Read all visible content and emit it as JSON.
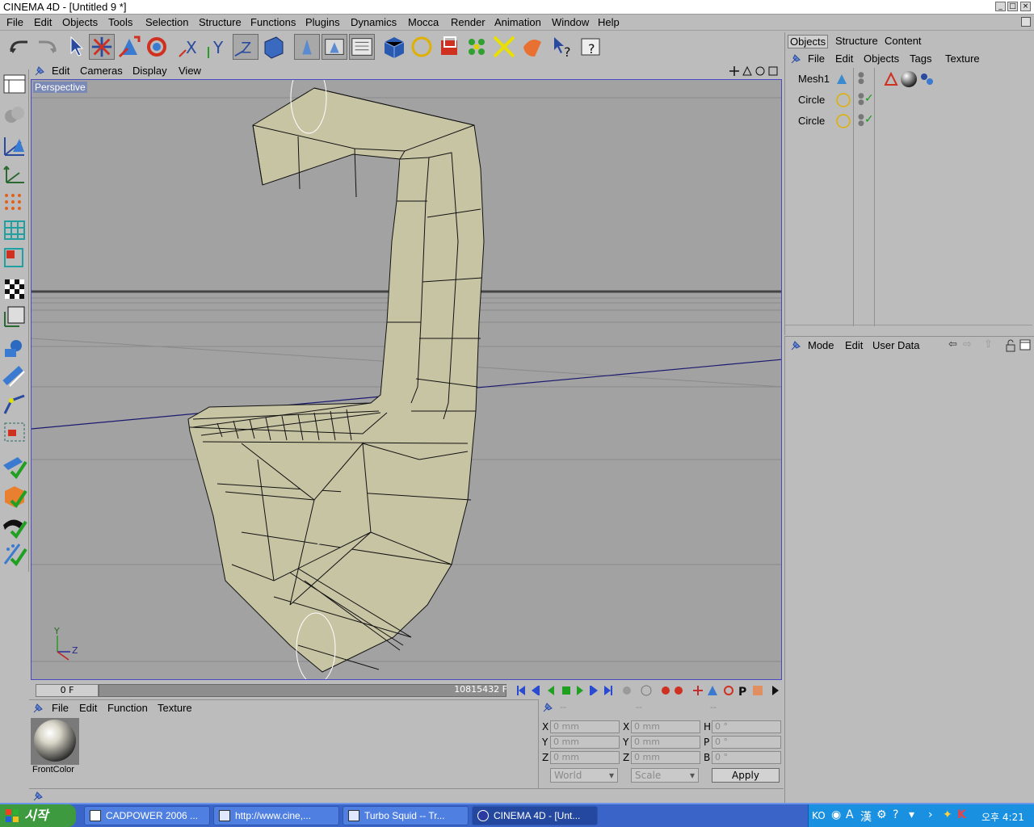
{
  "window": {
    "title": "CINEMA 4D - [Untitled 9 *]"
  },
  "menubar": [
    "File",
    "Edit",
    "Objects",
    "Tools",
    "Selection",
    "Structure",
    "Functions",
    "Plugins",
    "Dynamics",
    "Mocca",
    "Render",
    "Animation",
    "Window",
    "Help"
  ],
  "viewport": {
    "menu": [
      "Edit",
      "Cameras",
      "Display",
      "View"
    ],
    "label": "Perspective",
    "axis": {
      "y": "Y",
      "z": "Z"
    }
  },
  "timeline": {
    "start_frame": "0 F",
    "end_frame": "10815432 F"
  },
  "material_manager": {
    "menu": [
      "File",
      "Edit",
      "Function",
      "Texture"
    ],
    "materials": [
      {
        "name": "FrontColor"
      }
    ]
  },
  "coordinates": {
    "header": [
      "--",
      "--",
      "--"
    ],
    "rows": [
      {
        "l1": "X",
        "v1": "0 mm",
        "l2": "X",
        "v2": "0 mm",
        "l3": "H",
        "v3": "0 °"
      },
      {
        "l1": "Y",
        "v1": "0 mm",
        "l2": "Y",
        "v2": "0 mm",
        "l3": "P",
        "v3": "0 °"
      },
      {
        "l1": "Z",
        "v1": "0 mm",
        "l2": "Z",
        "v2": "0 mm",
        "l3": "B",
        "v3": "0 °"
      }
    ],
    "mode_select": "World",
    "size_select": "Scale",
    "apply_label": "Apply"
  },
  "object_manager": {
    "tabs": [
      "Objects",
      "Structure",
      "Content"
    ],
    "menu": [
      "File",
      "Edit",
      "Objects",
      "Tags",
      "Texture"
    ],
    "objects": [
      {
        "name": "Mesh1",
        "icon": "polygon-object-icon",
        "checked": false
      },
      {
        "name": "Circle",
        "icon": "circle-spline-icon",
        "checked": true
      },
      {
        "name": "Circle",
        "icon": "circle-spline-icon",
        "checked": true
      }
    ]
  },
  "attribute_manager": {
    "menu": [
      "Mode",
      "Edit",
      "User Data"
    ]
  },
  "taskbar": {
    "start_label": "시작",
    "tasks": [
      "CADPOWER 2006 ...",
      "http://www.cine,...",
      "Turbo Squid -- Tr...",
      "CINEMA 4D - [Unt..."
    ],
    "tray_lang": "KO",
    "clock": "오후 4:21"
  },
  "colors": {
    "background": "#bcbcbc",
    "viewport": "#a2a2a2",
    "mesh_fill": "#c7c4a4",
    "taskbar": "#3a64c8"
  }
}
